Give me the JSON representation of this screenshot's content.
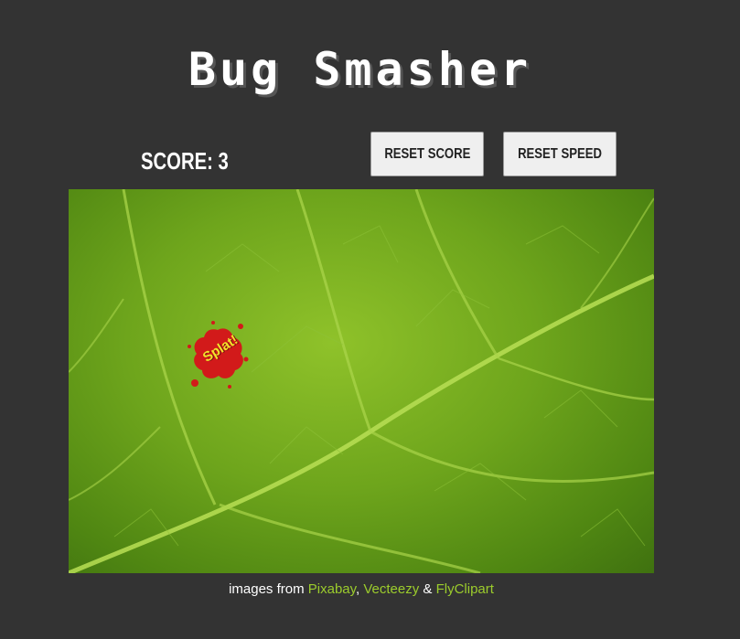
{
  "game": {
    "title": "Bug Smasher",
    "score_label": "SCORE: 3",
    "score_value": 3
  },
  "controls": {
    "reset_score_label": "RESET SCORE",
    "reset_speed_label": "RESET SPEED"
  },
  "playfield": {
    "background": "green leaf",
    "splat_text": "Splat!"
  },
  "credits": {
    "prefix": "images from ",
    "links": [
      "Pixabay",
      "Vecteezy",
      "FlyClipart"
    ],
    "sep1": ", ",
    "sep2": " & "
  },
  "colors": {
    "page_bg": "#333333",
    "link": "#9ccc2c",
    "splat": "#d21a1a",
    "splat_text": "#f3e22a"
  }
}
